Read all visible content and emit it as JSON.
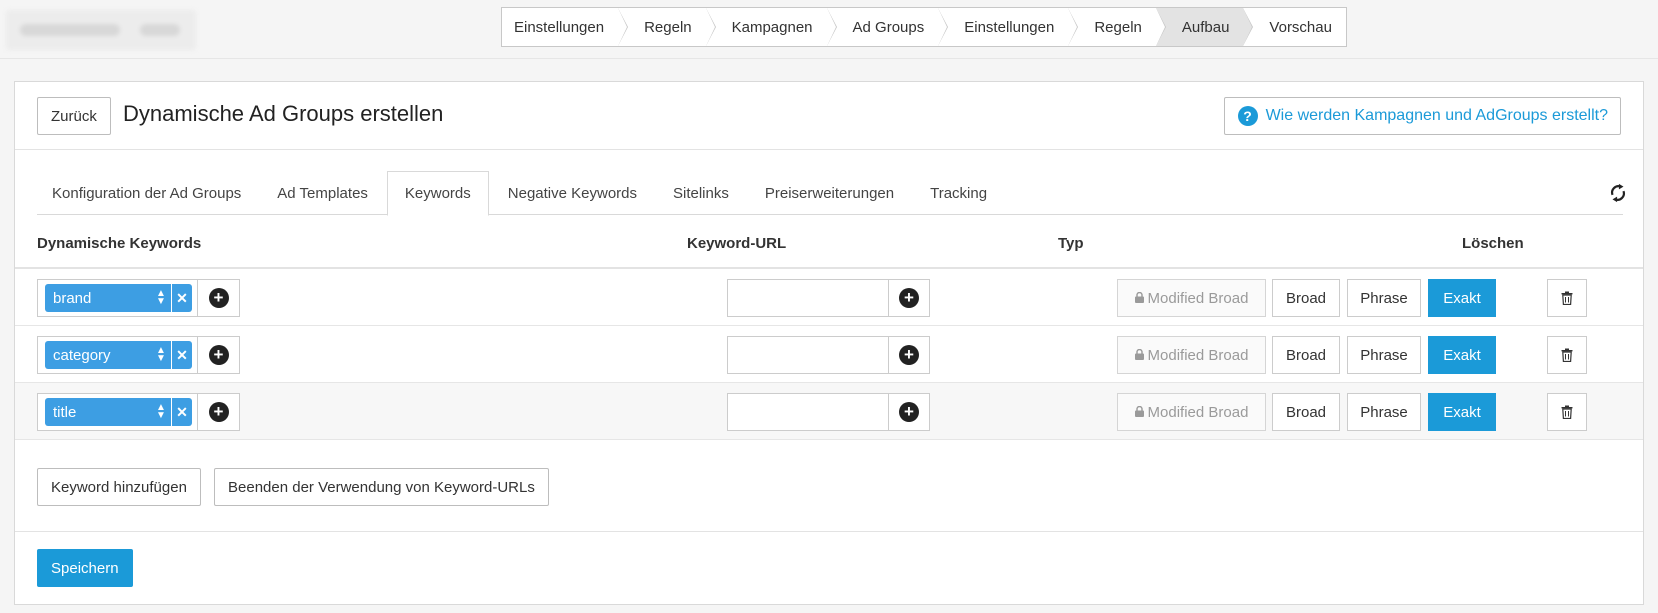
{
  "wizard": {
    "steps": [
      {
        "label": "Einstellungen"
      },
      {
        "label": "Regeln"
      },
      {
        "label": "Kampagnen"
      },
      {
        "label": "Ad Groups"
      },
      {
        "label": "Einstellungen"
      },
      {
        "label": "Regeln"
      },
      {
        "label": "Aufbau",
        "active": true
      },
      {
        "label": "Vorschau"
      }
    ]
  },
  "header": {
    "back_label": "Zurück",
    "title": "Dynamische Ad Groups erstellen",
    "help_label": "Wie werden Kampagnen und AdGroups erstellt?"
  },
  "tabs": [
    {
      "label": "Konfiguration der Ad Groups"
    },
    {
      "label": "Ad Templates"
    },
    {
      "label": "Keywords",
      "active": true
    },
    {
      "label": "Negative Keywords"
    },
    {
      "label": "Sitelinks"
    },
    {
      "label": "Preiserweiterungen"
    },
    {
      "label": "Tracking"
    }
  ],
  "columns": {
    "keywords": "Dynamische Keywords",
    "url": "Keyword-URL",
    "type": "Typ",
    "delete": "Löschen"
  },
  "rows": [
    {
      "keyword": "brand",
      "url": "",
      "type_locked": "Modified Broad",
      "type_broad": "Broad",
      "type_phrase": "Phrase",
      "type_exact": "Exakt",
      "selected": "Exakt"
    },
    {
      "keyword": "category",
      "url": "",
      "type_locked": "Modified Broad",
      "type_broad": "Broad",
      "type_phrase": "Phrase",
      "type_exact": "Exakt",
      "selected": "Exakt"
    },
    {
      "keyword": "title",
      "url": "",
      "type_locked": "Modified Broad",
      "type_broad": "Broad",
      "type_phrase": "Phrase",
      "type_exact": "Exakt",
      "selected": "Exakt"
    }
  ],
  "footer": {
    "add_keyword": "Keyword hinzufügen",
    "stop_urls": "Beenden der Verwendung von Keyword-URLs",
    "save": "Speichern"
  },
  "colors": {
    "accent": "#1b9ad8",
    "chip": "#3d9ee3",
    "active_step": "#e3e3e3"
  }
}
